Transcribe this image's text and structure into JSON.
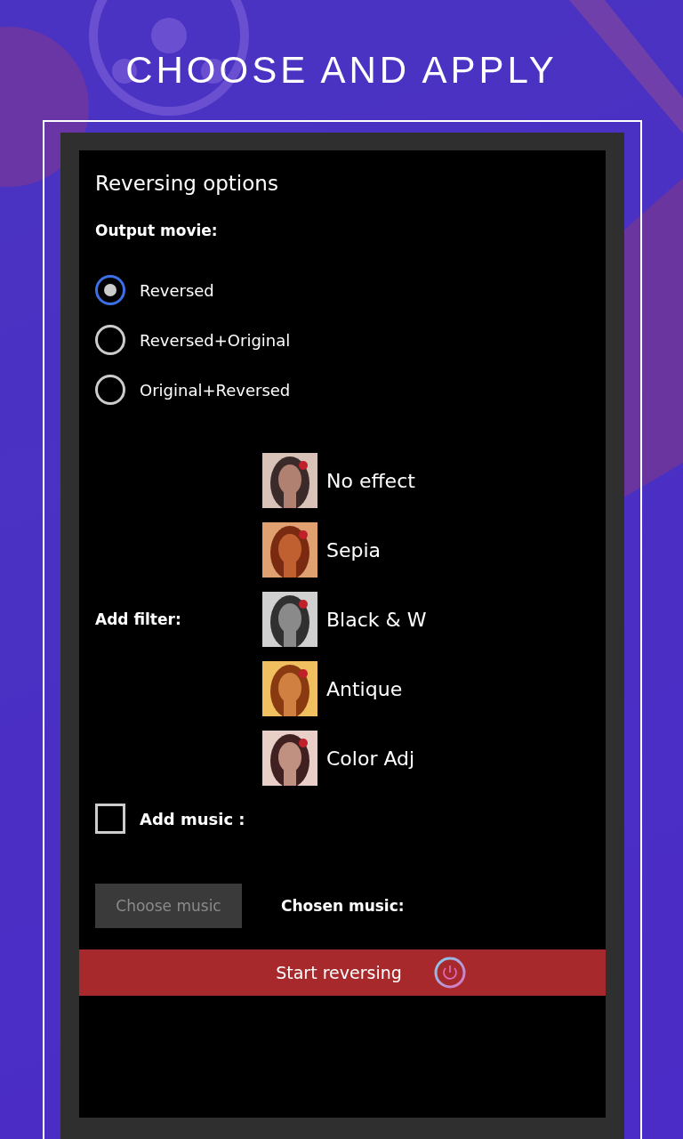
{
  "title": "CHOOSE AND APPLY",
  "panel_title": "Reversing options",
  "output": {
    "label": "Output movie:",
    "options": [
      {
        "label": "Reversed",
        "selected": true
      },
      {
        "label": "Reversed+Original",
        "selected": false
      },
      {
        "label": "Original+Reversed",
        "selected": false
      }
    ]
  },
  "filter": {
    "label": "Add filter:",
    "items": [
      {
        "label": "No effect"
      },
      {
        "label": "Sepia"
      },
      {
        "label": "Black & W"
      },
      {
        "label": "Antique"
      },
      {
        "label": "Color Adj"
      }
    ]
  },
  "music": {
    "label": "Add music :",
    "checked": false
  },
  "choose_button": {
    "label": "Choose music",
    "disabled": true
  },
  "chosen_label": "Chosen music:",
  "start_button": "Start reversing"
}
